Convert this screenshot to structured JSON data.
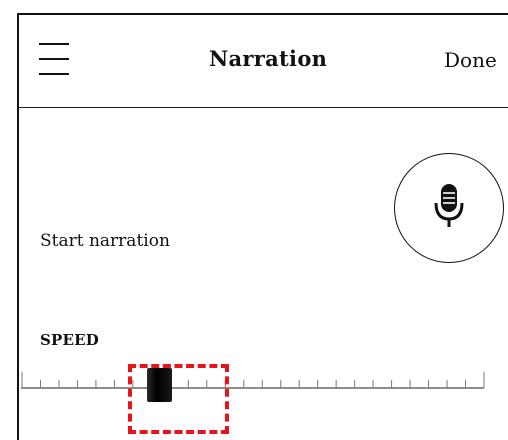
{
  "header": {
    "title": "Narration",
    "done_label": "Done"
  },
  "icons": {
    "menu": "hamburger-menu-icon",
    "mic": "microphone-icon"
  },
  "narration": {
    "start_label": "Start narration"
  },
  "speed": {
    "label": "SPEED",
    "slider_fraction": 0.3
  },
  "colors": {
    "text": "#111111",
    "highlight": "#e8141b",
    "background": "#ffffff"
  }
}
